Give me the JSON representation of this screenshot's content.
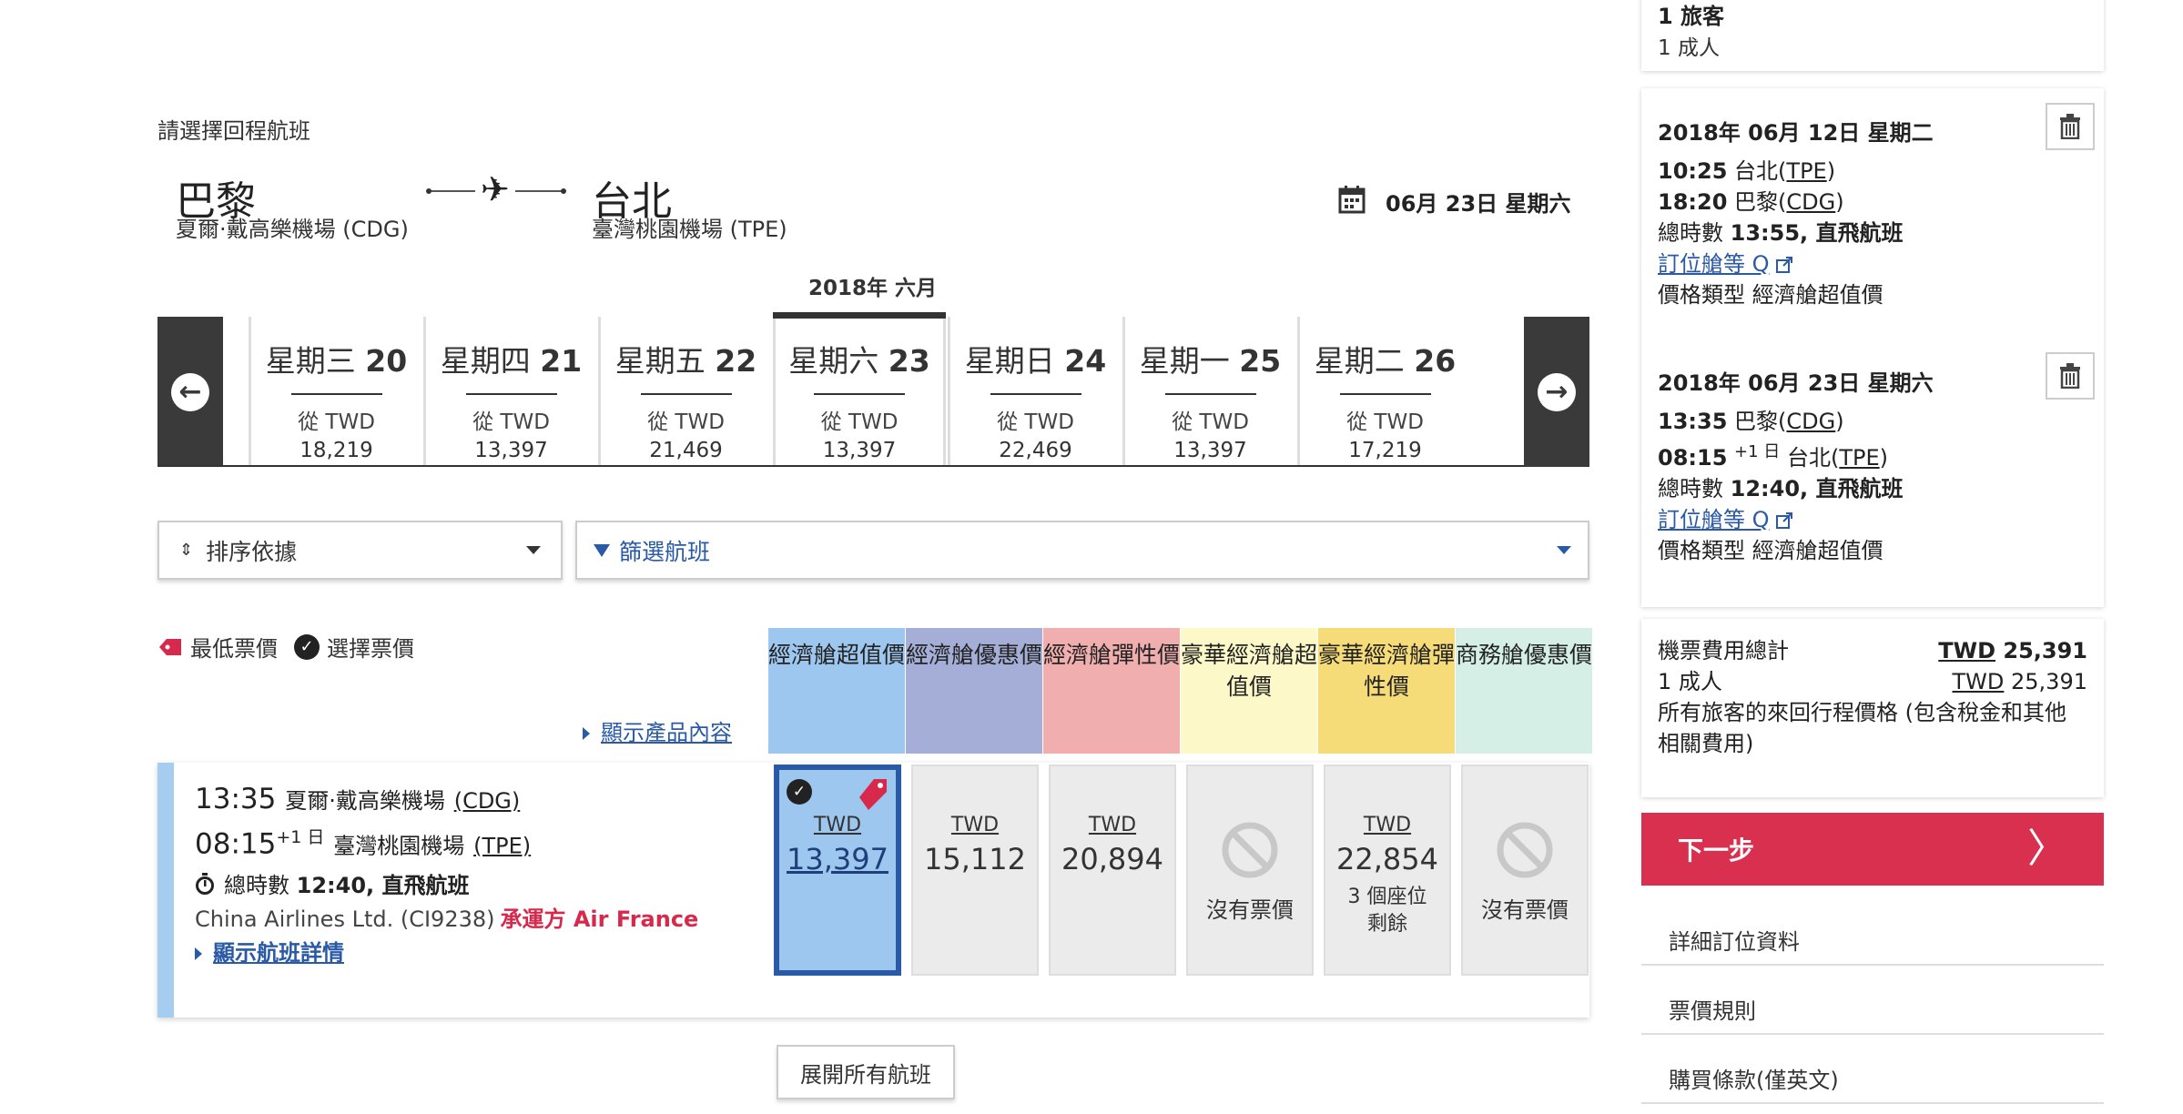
{
  "header": {
    "select_return": "請選擇回程航班",
    "origin_city": "巴黎",
    "origin_airport": "夏爾·戴高樂機場 (CDG)",
    "dest_city": "台北",
    "dest_airport": "臺灣桃園機場 (TPE)",
    "selected_date": "06月 23日 星期六",
    "month_label": "2018年 六月"
  },
  "date_strip": {
    "days": [
      {
        "name": "星期三",
        "num": "20",
        "from": "從 TWD",
        "price": "18,219"
      },
      {
        "name": "星期四",
        "num": "21",
        "from": "從 TWD",
        "price": "13,397"
      },
      {
        "name": "星期五",
        "num": "22",
        "from": "從 TWD",
        "price": "21,469"
      },
      {
        "name": "星期六",
        "num": "23",
        "from": "從 TWD",
        "price": "13,397"
      },
      {
        "name": "星期日",
        "num": "24",
        "from": "從 TWD",
        "price": "22,469"
      },
      {
        "name": "星期一",
        "num": "25",
        "from": "從 TWD",
        "price": "13,397"
      },
      {
        "name": "星期二",
        "num": "26",
        "from": "從 TWD",
        "price": "17,219"
      }
    ]
  },
  "controls": {
    "sort_label": "排序依據",
    "filter_label": "篩選航班"
  },
  "legend": {
    "lowest": "最低票價",
    "selected": "選擇票價",
    "show_product": "顯示產品內容"
  },
  "fare_headers": [
    {
      "label": "經濟艙超值價",
      "color": "#9ec7ef"
    },
    {
      "label": "經濟艙優惠價",
      "color": "#a4aed6"
    },
    {
      "label": "經濟艙彈性價",
      "color": "#f0aeae"
    },
    {
      "label": "豪華經濟艙超值價",
      "color": "#fdf8c8"
    },
    {
      "label": "豪華經濟艙彈性價",
      "color": "#f6dc78"
    },
    {
      "label": "商務艙優惠價",
      "color": "#d5efe6"
    }
  ],
  "flight": {
    "dep_time": "13:35",
    "dep_airport": "夏爾·戴高樂機場",
    "dep_code": "(CDG)",
    "arr_time": "08:15",
    "arr_offset": "+1 日",
    "arr_airport": "臺灣桃園機場",
    "arr_code": "(TPE)",
    "duration_label": "總時數",
    "duration": "12:40, 直飛航班",
    "carrier": "China Airlines Ltd. (CI9238)",
    "operated_by": "承運方 Air France",
    "details_link": "顯示航班詳情"
  },
  "fares": [
    {
      "currency": "TWD",
      "price": "13,397",
      "selected": true
    },
    {
      "currency": "TWD",
      "price": "15,112"
    },
    {
      "currency": "TWD",
      "price": "20,894"
    },
    {
      "unavailable": "沒有票價"
    },
    {
      "currency": "TWD",
      "price": "22,854",
      "seats": "3 個座位剩餘"
    },
    {
      "unavailable": "沒有票價"
    }
  ],
  "expand_all": "展開所有航班",
  "sidebar": {
    "passengers": "1 旅客",
    "adults": "1 成人",
    "segments": [
      {
        "date": "2018年 06月 12日 星期二",
        "dep_time": "10:25",
        "dep_city": "台北",
        "dep_code": "TPE",
        "arr_time": "18:20",
        "arr_city": "巴黎",
        "arr_code": "CDG",
        "duration_label": "總時數",
        "duration": "13:55, 直飛航班",
        "class_link": "訂位艙等 Q",
        "fare_type_label": "價格類型",
        "fare_type": "經濟艙超值價"
      },
      {
        "date": "2018年 06月 23日 星期六",
        "dep_time": "13:35",
        "dep_city": "巴黎",
        "dep_code": "CDG",
        "arr_time": "08:15",
        "arr_offset": "+1 日",
        "arr_city": "台北",
        "arr_code": "TPE",
        "duration_label": "總時數",
        "duration": "12:40, 直飛航班",
        "class_link": "訂位艙等 Q",
        "fare_type_label": "價格類型",
        "fare_type": "經濟艙超值價"
      }
    ],
    "total_label": "機票費用總計",
    "total_currency": "TWD",
    "total_amount": "25,391",
    "adult_label": "1 成人",
    "adult_currency": "TWD",
    "adult_amount": "25,391",
    "total_note": "所有旅客的來回行程價格 (包含稅金和其他相關費用)",
    "next_label": "下一步",
    "links": [
      "詳細訂位資料",
      "票價規則",
      "購買條款(僅英文)"
    ]
  }
}
